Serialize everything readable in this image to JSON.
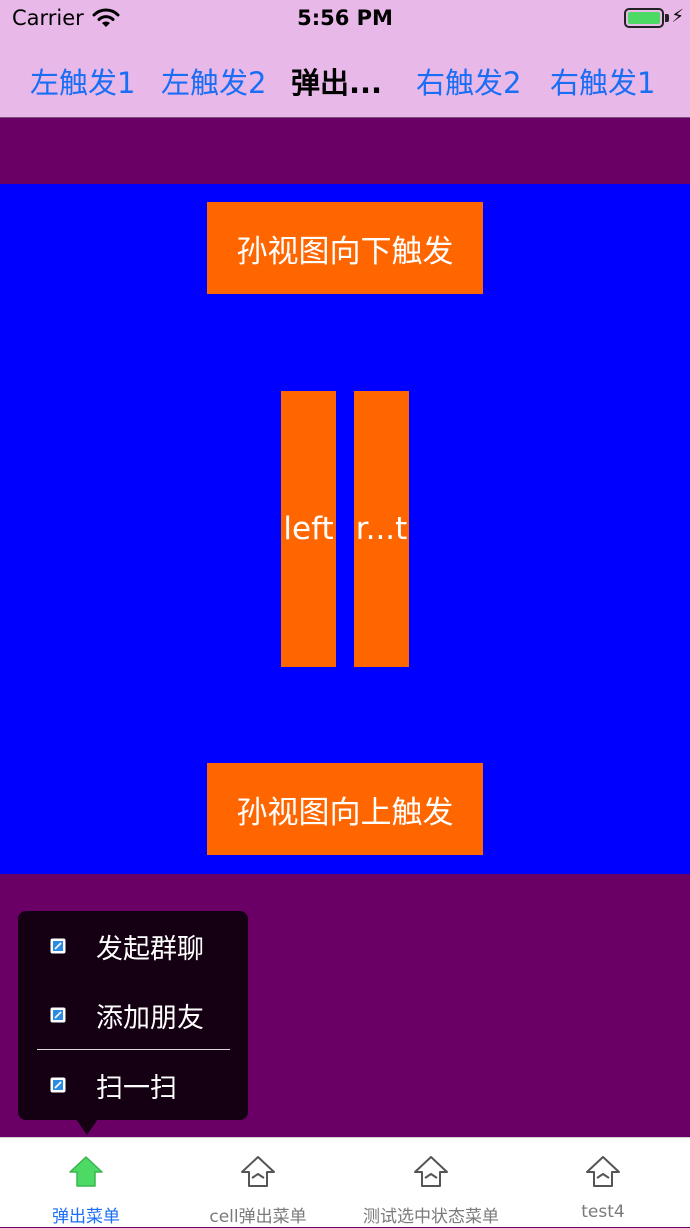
{
  "status_bar": {
    "carrier": "Carrier",
    "time": "5:56 PM",
    "wifi_icon": "wifi-icon",
    "battery_icon": "battery-icon",
    "charging_icon": "lightning-icon"
  },
  "navbar": {
    "left_items": [
      "左触发1",
      "左触发2"
    ],
    "title": "弹出...",
    "right_items": [
      "右触发2",
      "右触发1"
    ]
  },
  "content": {
    "top_button": "孙视图向下触发",
    "left_button": "left",
    "right_button": "r...t",
    "bottom_button": "孙视图向上触发"
  },
  "popup_menu": {
    "items": [
      {
        "label": "发起群聊",
        "icon": "edit-icon"
      },
      {
        "label": "添加朋友",
        "icon": "edit-icon"
      },
      {
        "label": "扫一扫",
        "icon": "edit-icon"
      }
    ]
  },
  "tabbar": {
    "tabs": [
      {
        "label": "弹出菜单",
        "icon": "home-icon",
        "active": true
      },
      {
        "label": "cell弹出菜单",
        "icon": "home-icon",
        "active": false
      },
      {
        "label": "测试选中状态菜单",
        "icon": "home-icon",
        "active": false
      },
      {
        "label": "test4",
        "icon": "home-icon",
        "active": false
      }
    ]
  },
  "colors": {
    "accent": "#1a6ef5",
    "background": "#6a0066",
    "content_area": "#0000ff",
    "button": "#ff6600",
    "nav_bar": "#e7b8e8",
    "active_tab_icon": "#4cd964"
  }
}
